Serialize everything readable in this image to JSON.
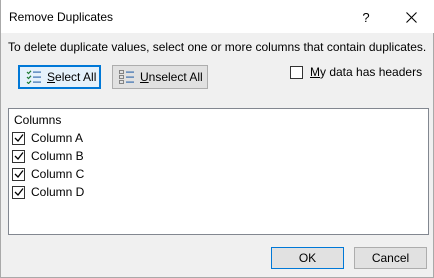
{
  "window": {
    "title": "Remove Duplicates",
    "help_label": "?"
  },
  "instruction": "To delete duplicate values, select one or more columns that contain duplicates.",
  "toolbar": {
    "select_all_prefix": "",
    "select_all_accel": "S",
    "select_all_rest": "elect All",
    "unselect_all_accel": "U",
    "unselect_all_rest": "nselect All"
  },
  "headers_option": {
    "accel": "M",
    "rest": "y data has headers",
    "checked": false
  },
  "columns_list": {
    "header": "Columns",
    "items": [
      {
        "label": "Column A",
        "checked": true
      },
      {
        "label": "Column B",
        "checked": true
      },
      {
        "label": "Column C",
        "checked": true
      },
      {
        "label": "Column D",
        "checked": true
      }
    ]
  },
  "footer": {
    "ok_label": "OK",
    "cancel_label": "Cancel"
  },
  "colors": {
    "accent": "#0078d7",
    "check_mark": "#000000"
  },
  "icons": {
    "select_all": "select-all-list-icon",
    "unselect_all": "unselect-all-list-icon"
  }
}
